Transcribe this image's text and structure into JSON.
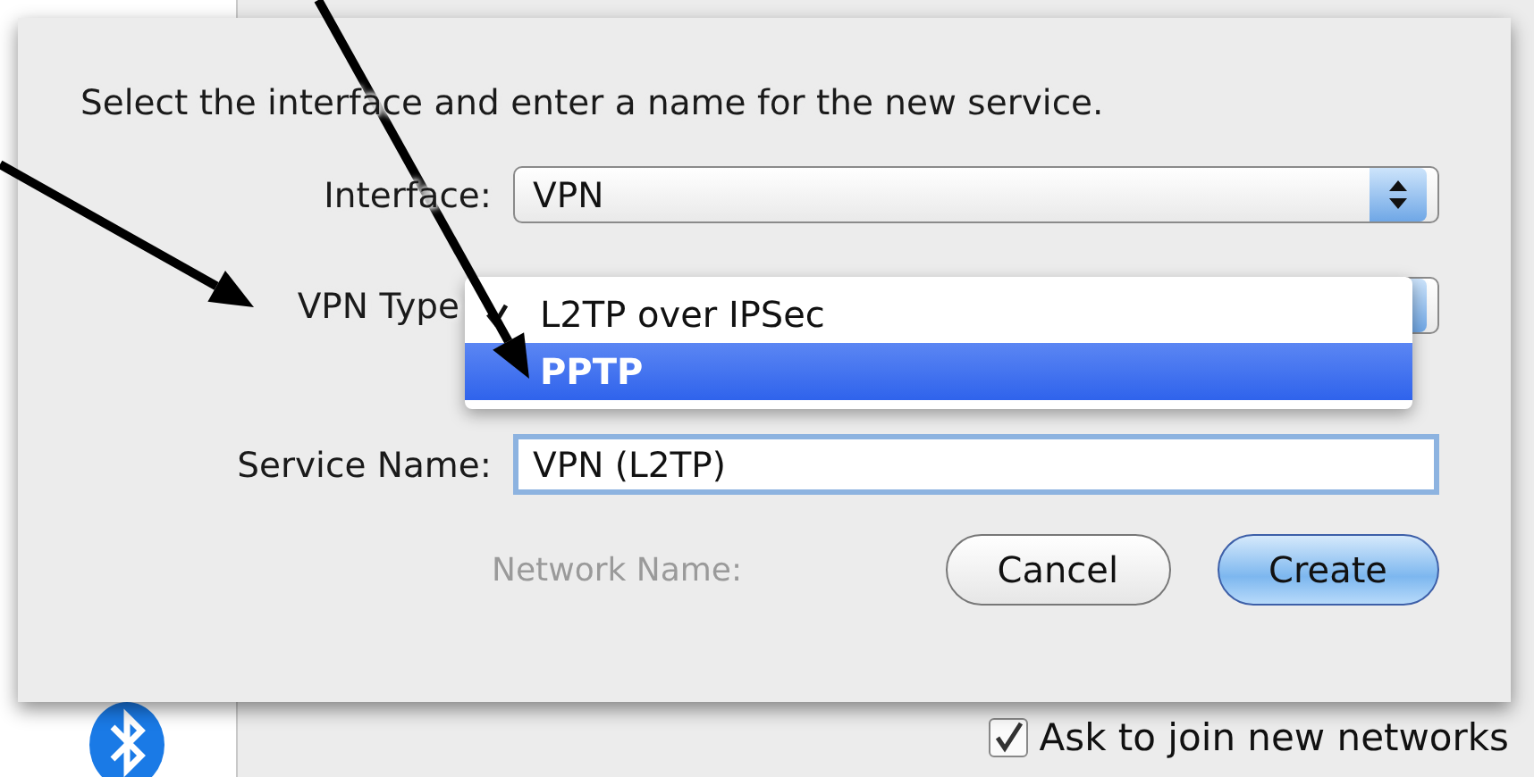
{
  "sheet": {
    "prompt": "Select the interface and enter a name for the new service.",
    "interface": {
      "label": "Interface:",
      "value": "VPN"
    },
    "vpn_type": {
      "label": "VPN Type",
      "expanded": true,
      "menu": [
        {
          "label": "L2TP over IPSec",
          "checked": true,
          "selected": false
        },
        {
          "label": "PPTP",
          "checked": false,
          "selected": true
        }
      ]
    },
    "service_name": {
      "label": "Service Name:",
      "value": "VPN (L2TP)"
    },
    "background_label": "Network Name:",
    "buttons": [
      {
        "label": "Cancel",
        "default": false
      },
      {
        "label": "Create",
        "default": true
      }
    ]
  },
  "background": {
    "checkbox": {
      "label": "Ask to join new networks",
      "checked": true
    }
  }
}
